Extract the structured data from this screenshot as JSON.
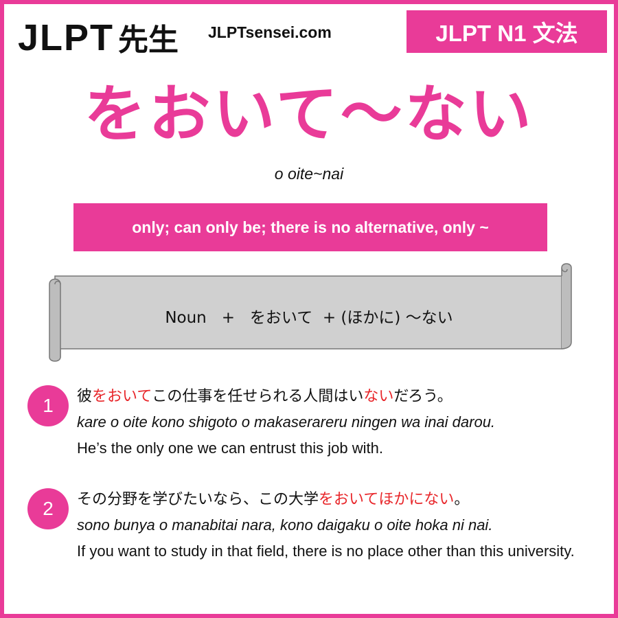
{
  "header": {
    "logo_text": "JLPT",
    "logo_kanji": "先生",
    "site": "JLPTsensei.com",
    "level_badge": "JLPT N1 文法"
  },
  "grammar": {
    "title": "をおいて～ない",
    "romaji": "o oite~nai",
    "meaning": "only; can only be; there is no alternative, only ~",
    "formation": "Noun   +   をおいて  + (ほかに) ～ない"
  },
  "examples": [
    {
      "number": "1",
      "jp_parts": [
        "彼",
        "をおいて",
        "この仕事を任せられる人間はい",
        "ない",
        "だろう。"
      ],
      "romaji": "kare o oite kono shigoto o makaserareru ningen wa inai darou.",
      "english": "He’s the only one we can entrust this job with."
    },
    {
      "number": "2",
      "jp_parts": [
        "その分野を学びたいなら、この大学",
        "をおいてほかにない",
        "。"
      ],
      "romaji": "sono bunya o manabitai nara, kono daigaku o oite hoka ni nai.",
      "english": "If you want to study in that field, there is no place other than this university."
    }
  ],
  "colors": {
    "brand_pink": "#e93b98",
    "highlight_red": "#e8262a",
    "scroll_gray": "#d0d0d0"
  }
}
